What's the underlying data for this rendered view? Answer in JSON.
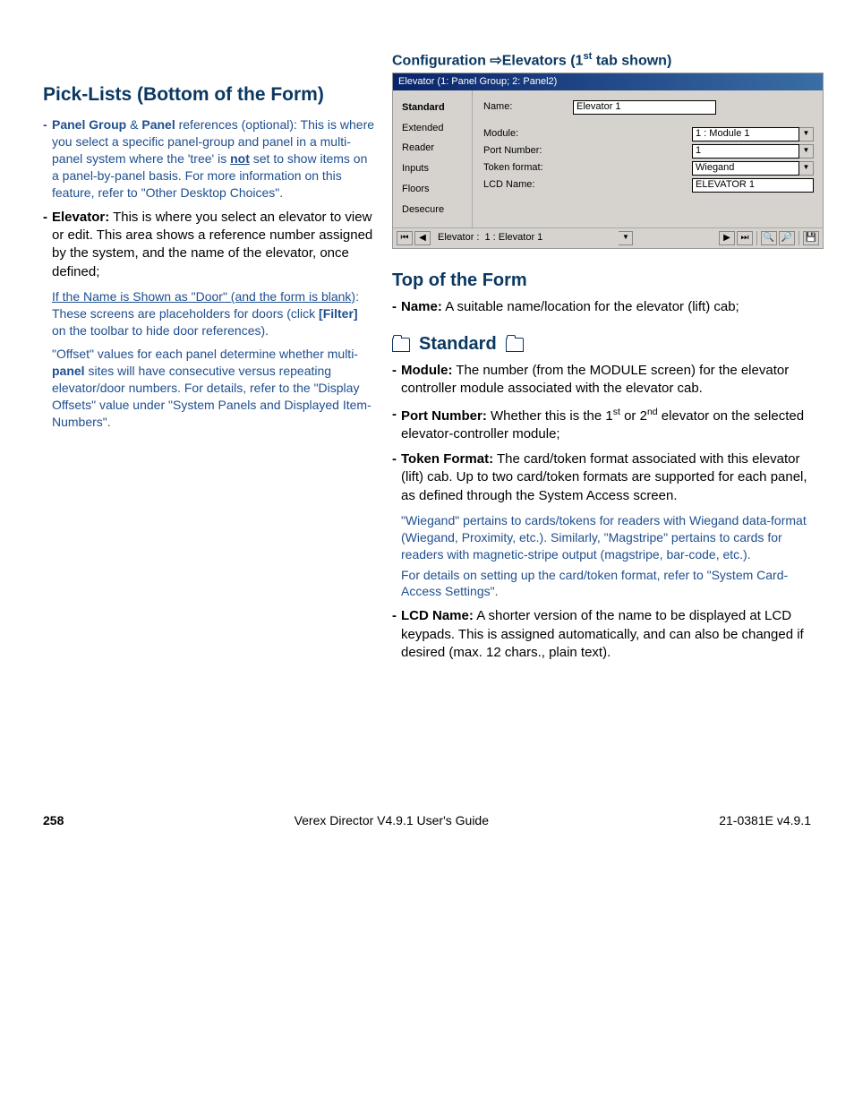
{
  "left": {
    "heading": "Pick-Lists (Bottom of the Form)",
    "item1_lead": "Panel Group",
    "item1_mid": " & ",
    "item1_lead2": "Panel",
    "item1_rest": " references (optional):",
    "item1_body": " This is where you select a specific panel-group and panel in a multi-panel system where the 'tree' is ",
    "item1_not": "not",
    "item1_body2": " set to show items on a panel-by-panel basis.  For more information on this feature, refer to \"Other Desktop Choices\".",
    "item2_lead": "Elevator:",
    "item2_body": " This is where you select an elevator to view or edit.  This area shows a reference number assigned by the system, and the name of the elevator, once defined;",
    "note1_u": "If the Name is Shown as \"Door\" (and the form is blank)",
    "note1_rest": ":  These screens are placeholders for doors (click ",
    "note1_filter": "[Filter]",
    "note1_rest2": " on the toolbar to hide door references).",
    "note2": "\"Offset\" values for each panel determine whether multi-",
    "note2_b": "panel",
    "note2_rest": " sites will have consecutive versus repeating elevator/door numbers.  For details, refer to the \"Display Offsets\" value under \"System Panels and Displayed Item-Numbers\"."
  },
  "right": {
    "config_head_a": "Configuration ",
    "config_head_b": "Elevators    (1",
    "config_head_sup": "st",
    "config_head_c": " tab shown)",
    "dialog": {
      "title": "Elevator    (1: Panel Group; 2: Panel2)",
      "tabs": [
        "Standard",
        "Extended",
        "Reader",
        "Inputs",
        "Floors",
        "Desecure"
      ],
      "name_label": "Name:",
      "name_value": "Elevator 1",
      "rows": [
        {
          "label": "Module:",
          "value": "1 : Module 1",
          "combo": true
        },
        {
          "label": "Port Number:",
          "value": "1",
          "combo": true
        },
        {
          "label": "Token format:",
          "value": "Wiegand",
          "combo": true
        },
        {
          "label": "LCD Name:",
          "value": "ELEVATOR 1",
          "combo": false
        }
      ],
      "nav_label": "Elevator :",
      "nav_value": "1 : Elevator 1"
    },
    "top_heading": "Top of the Form",
    "top_item_lead": "Name:",
    "top_item_body": " A suitable name/location for the elevator (lift) cab;",
    "std_heading": "Standard",
    "std1_lead": "Module:",
    "std1_body": " The number (from the MODULE screen) for the elevator controller module associated with the elevator cab.",
    "std2_lead": "Port Number:",
    "std2_a": " Whether this is the 1",
    "std2_sup1": "st",
    "std2_b": " or 2",
    "std2_sup2": "nd",
    "std2_c": " elevator on the selected elevator-controller module;",
    "std3_lead": "Token Format:",
    "std3_body": " The card/token format associated with this elevator (lift) cab.  Up to two card/token formats are supported for each panel, as defined through the System Access screen.",
    "std3_note1": "\"Wiegand\" pertains to cards/tokens for readers with Wiegand data-format (Wiegand, Proximity, etc.).  Similarly, \"Magstripe\" pertains to cards for readers with magnetic-stripe output (magstripe, bar-code, etc.).",
    "std3_note2": "For details on setting up the card/token format, refer to \"System Card-Access Settings\".",
    "std4_lead": "LCD Name:",
    "std4_body": " A shorter version of the name to be displayed at LCD keypads.  This is assigned automatically, and can also be changed if desired (max. 12 chars., plain text)."
  },
  "footer": {
    "page": "258",
    "center": "Verex Director V4.9.1 User's Guide",
    "right": "21-0381E v4.9.1"
  }
}
